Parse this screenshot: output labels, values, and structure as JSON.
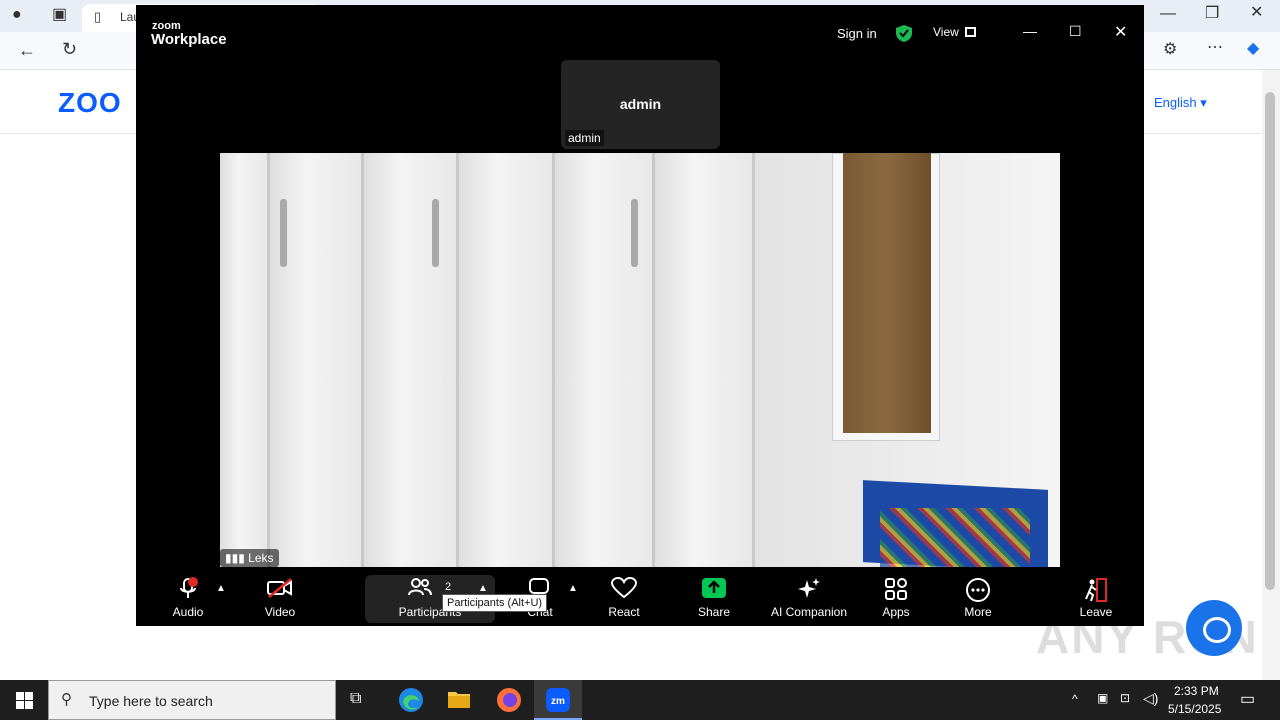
{
  "browser": {
    "tab_title": "Lau",
    "english_label": "English",
    "logo_text": "ZOO",
    "watermark": "ANY RUN"
  },
  "zoom": {
    "brand_small": "zoom",
    "brand_big": "Workplace",
    "sign_in": "Sign in",
    "view": "View",
    "tile_name": "admin",
    "tile_label": "admin",
    "video_label": "Leks",
    "toolbar": {
      "audio": "Audio",
      "video": "Video",
      "participants": "Participants",
      "participants_count": "2",
      "chat": "Chat",
      "react": "React",
      "share": "Share",
      "ai_companion": "AI Companion",
      "apps": "Apps",
      "more": "More",
      "leave": "Leave"
    },
    "tooltip": "Participants (Alt+U)"
  },
  "taskbar": {
    "search_placeholder": "Type here to search",
    "time": "2:33 PM",
    "date": "5/15/2025"
  },
  "colors": {
    "zoom_blue": "#0b5cff",
    "share_green": "#00c853",
    "leave_red": "#e02828"
  }
}
